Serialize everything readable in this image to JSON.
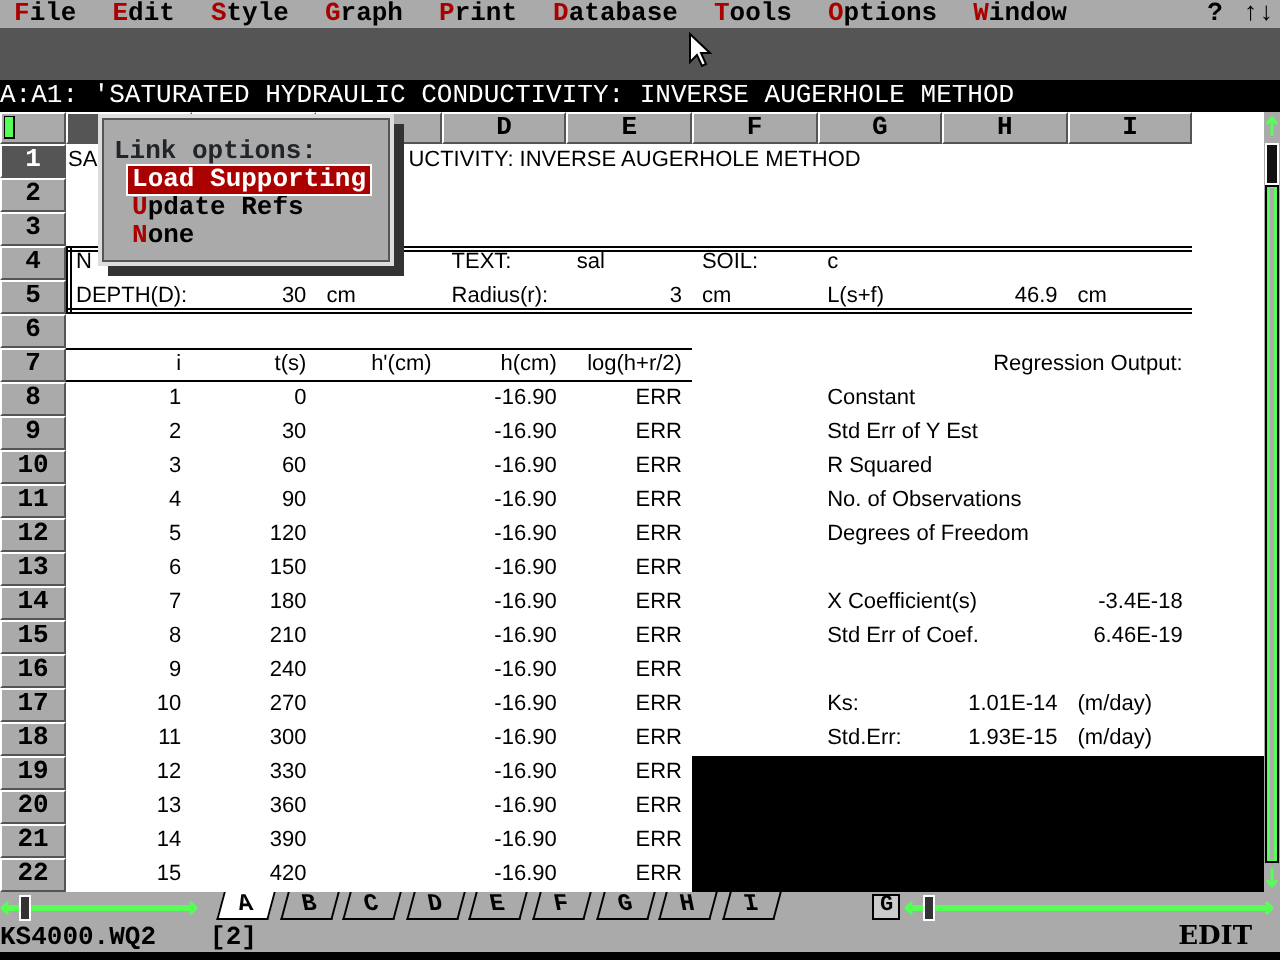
{
  "menu_bar": {
    "items": [
      {
        "label": "File"
      },
      {
        "label": "Edit"
      },
      {
        "label": "Style"
      },
      {
        "label": "Graph"
      },
      {
        "label": "Print"
      },
      {
        "label": "Database"
      },
      {
        "label": "Tools"
      },
      {
        "label": "Options"
      },
      {
        "label": "Window"
      }
    ],
    "help": "?",
    "arrows": "↑↓"
  },
  "input_line": "A:A1: 'SATURATED HYDRAULIC CONDUCTIVITY: INVERSE AUGERHOLE METHOD",
  "column_headers": {
    "A": {
      "selected": true
    },
    "D": {
      "label": "D",
      "selected": false
    },
    "E": {
      "label": "E",
      "selected": false
    },
    "F": {
      "label": "F",
      "selected": false
    },
    "G": {
      "label": "G",
      "selected": false
    },
    "H": {
      "label": "H",
      "selected": false
    },
    "I": {
      "label": "I",
      "selected": false
    }
  },
  "rows": [
    {
      "number": "1",
      "selected": true,
      "cells": {
        "A": {
          "text": "SA",
          "kind": "cursor"
        },
        "C": {
          "text": "UCTIVITY: INVERSE AUGERHOLE METHOD",
          "kind": "clipped"
        }
      }
    },
    {
      "number": "2",
      "selected": false,
      "cells": {}
    },
    {
      "number": "3",
      "selected": false,
      "cells": {}
    },
    {
      "number": "4",
      "selected": false,
      "double_rule_above": true,
      "boxed": true,
      "cells": {
        "A": {
          "text": "N",
          "kind": "label"
        },
        "D": {
          "text": "TEXT:",
          "kind": "label"
        },
        "E": {
          "text": "sal",
          "kind": "label"
        },
        "F": {
          "text": "SOIL:",
          "kind": "label"
        },
        "G": {
          "text": "c",
          "kind": "label"
        }
      }
    },
    {
      "number": "5",
      "selected": false,
      "double_rule_below": true,
      "boxed": true,
      "cells": {
        "A": {
          "text": "DEPTH(D):",
          "kind": "label"
        },
        "B": {
          "text": "30",
          "kind": "number"
        },
        "C": {
          "text": "cm",
          "kind": "label"
        },
        "D": {
          "text": "Radius(r):",
          "kind": "label"
        },
        "E": {
          "text": "3",
          "kind": "number"
        },
        "F": {
          "text": "cm",
          "kind": "label"
        },
        "G": {
          "text": "L(s+f)",
          "kind": "label"
        },
        "H": {
          "text": "46.9",
          "kind": "number"
        },
        "I": {
          "text": "cm",
          "kind": "label"
        }
      }
    },
    {
      "number": "6",
      "selected": false,
      "cells": {}
    },
    {
      "number": "7",
      "selected": false,
      "single_rule_above": true,
      "single_rule_below": true,
      "cells": {
        "A": {
          "text": "i",
          "kind": "number"
        },
        "B": {
          "text": "t(s)",
          "kind": "number"
        },
        "C": {
          "text": "h'(cm)",
          "kind": "number"
        },
        "D": {
          "text": "h(cm)",
          "kind": "number"
        },
        "E": {
          "text": "log(h+r/2)",
          "kind": "number"
        },
        "I": {
          "text": "Regression Output:",
          "kind": "number"
        }
      }
    },
    {
      "number": "8",
      "selected": false,
      "cells": {
        "A": {
          "text": "1",
          "kind": "number"
        },
        "B": {
          "text": "0",
          "kind": "number"
        },
        "D": {
          "text": "-16.90",
          "kind": "number"
        },
        "E": {
          "text": "ERR",
          "kind": "number"
        },
        "G": {
          "text": "Constant",
          "kind": "label"
        }
      }
    },
    {
      "number": "9",
      "selected": false,
      "cells": {
        "A": {
          "text": "2",
          "kind": "number"
        },
        "B": {
          "text": "30",
          "kind": "number"
        },
        "D": {
          "text": "-16.90",
          "kind": "number"
        },
        "E": {
          "text": "ERR",
          "kind": "number"
        },
        "G": {
          "text": "Std Err of Y Est",
          "kind": "label"
        }
      }
    },
    {
      "number": "10",
      "selected": false,
      "cells": {
        "A": {
          "text": "3",
          "kind": "number"
        },
        "B": {
          "text": "60",
          "kind": "number"
        },
        "D": {
          "text": "-16.90",
          "kind": "number"
        },
        "E": {
          "text": "ERR",
          "kind": "number"
        },
        "G": {
          "text": "R Squared",
          "kind": "label"
        }
      }
    },
    {
      "number": "11",
      "selected": false,
      "cells": {
        "A": {
          "text": "4",
          "kind": "number"
        },
        "B": {
          "text": "90",
          "kind": "number"
        },
        "D": {
          "text": "-16.90",
          "kind": "number"
        },
        "E": {
          "text": "ERR",
          "kind": "number"
        },
        "G": {
          "text": "No. of Observations",
          "kind": "label"
        }
      }
    },
    {
      "number": "12",
      "selected": false,
      "cells": {
        "A": {
          "text": "5",
          "kind": "number"
        },
        "B": {
          "text": "120",
          "kind": "number"
        },
        "D": {
          "text": "-16.90",
          "kind": "number"
        },
        "E": {
          "text": "ERR",
          "kind": "number"
        },
        "G": {
          "text": "Degrees of Freedom",
          "kind": "label"
        }
      }
    },
    {
      "number": "13",
      "selected": false,
      "cells": {
        "A": {
          "text": "6",
          "kind": "number"
        },
        "B": {
          "text": "150",
          "kind": "number"
        },
        "D": {
          "text": "-16.90",
          "kind": "number"
        },
        "E": {
          "text": "ERR",
          "kind": "number"
        }
      }
    },
    {
      "number": "14",
      "selected": false,
      "cells": {
        "A": {
          "text": "7",
          "kind": "number"
        },
        "B": {
          "text": "180",
          "kind": "number"
        },
        "D": {
          "text": "-16.90",
          "kind": "number"
        },
        "E": {
          "text": "ERR",
          "kind": "number"
        },
        "G": {
          "text": "X Coefficient(s)",
          "kind": "label"
        },
        "I": {
          "text": "-3.4E-18",
          "kind": "number"
        }
      }
    },
    {
      "number": "15",
      "selected": false,
      "cells": {
        "A": {
          "text": "8",
          "kind": "number"
        },
        "B": {
          "text": "210",
          "kind": "number"
        },
        "D": {
          "text": "-16.90",
          "kind": "number"
        },
        "E": {
          "text": "ERR",
          "kind": "number"
        },
        "G": {
          "text": "Std Err of Coef.",
          "kind": "label"
        },
        "I": {
          "text": "6.46E-19",
          "kind": "number"
        }
      }
    },
    {
      "number": "16",
      "selected": false,
      "cells": {
        "A": {
          "text": "9",
          "kind": "number"
        },
        "B": {
          "text": "240",
          "kind": "number"
        },
        "D": {
          "text": "-16.90",
          "kind": "number"
        },
        "E": {
          "text": "ERR",
          "kind": "number"
        }
      }
    },
    {
      "number": "17",
      "selected": false,
      "cells": {
        "A": {
          "text": "10",
          "kind": "number"
        },
        "B": {
          "text": "270",
          "kind": "number"
        },
        "D": {
          "text": "-16.90",
          "kind": "number"
        },
        "E": {
          "text": "ERR",
          "kind": "number"
        },
        "G": {
          "text": "Ks:",
          "kind": "label"
        },
        "H": {
          "text": "1.01E-14",
          "kind": "number"
        },
        "I": {
          "text": "(m/day)",
          "kind": "label"
        }
      }
    },
    {
      "number": "18",
      "selected": false,
      "cells": {
        "A": {
          "text": "11",
          "kind": "number"
        },
        "B": {
          "text": "300",
          "kind": "number"
        },
        "D": {
          "text": "-16.90",
          "kind": "number"
        },
        "E": {
          "text": "ERR",
          "kind": "number"
        },
        "G": {
          "text": "Std.Err:",
          "kind": "label"
        },
        "H": {
          "text": "1.93E-15",
          "kind": "number"
        },
        "I": {
          "text": "(m/day)",
          "kind": "label"
        }
      }
    },
    {
      "number": "19",
      "selected": false,
      "cells": {
        "A": {
          "text": "12",
          "kind": "number"
        },
        "B": {
          "text": "330",
          "kind": "number"
        },
        "D": {
          "text": "-16.90",
          "kind": "number"
        },
        "E": {
          "text": "ERR",
          "kind": "number"
        }
      }
    },
    {
      "number": "20",
      "selected": false,
      "cells": {
        "A": {
          "text": "13",
          "kind": "number"
        },
        "B": {
          "text": "360",
          "kind": "number"
        },
        "D": {
          "text": "-16.90",
          "kind": "number"
        },
        "E": {
          "text": "ERR",
          "kind": "number"
        }
      }
    },
    {
      "number": "21",
      "selected": false,
      "cells": {
        "A": {
          "text": "14",
          "kind": "number"
        },
        "B": {
          "text": "390",
          "kind": "number"
        },
        "D": {
          "text": "-16.90",
          "kind": "number"
        },
        "E": {
          "text": "ERR",
          "kind": "number"
        }
      }
    },
    {
      "number": "22",
      "selected": false,
      "cells": {
        "A": {
          "text": "15",
          "kind": "number"
        },
        "B": {
          "text": "420",
          "kind": "number"
        },
        "D": {
          "text": "-16.90",
          "kind": "number"
        },
        "E": {
          "text": "ERR",
          "kind": "number"
        }
      }
    }
  ],
  "popup": {
    "title": "Link options:",
    "items": [
      {
        "label": "Load Supporting",
        "selected": true
      },
      {
        "label": "Update Refs",
        "selected": false
      },
      {
        "label": "None",
        "selected": false
      }
    ]
  },
  "tab_bar": {
    "tabs": [
      {
        "label": "A",
        "selected": true
      },
      {
        "label": "B",
        "selected": false
      },
      {
        "label": "C",
        "selected": false
      },
      {
        "label": "D",
        "selected": false
      },
      {
        "label": "E",
        "selected": false
      },
      {
        "label": "F",
        "selected": false
      },
      {
        "label": "G",
        "selected": false
      },
      {
        "label": "H",
        "selected": false
      },
      {
        "label": "I",
        "selected": false
      }
    ],
    "group_button": "G"
  },
  "status_bar": {
    "file": "KS4000.WQ2",
    "window": "[2]",
    "mode": "EDIT"
  }
}
